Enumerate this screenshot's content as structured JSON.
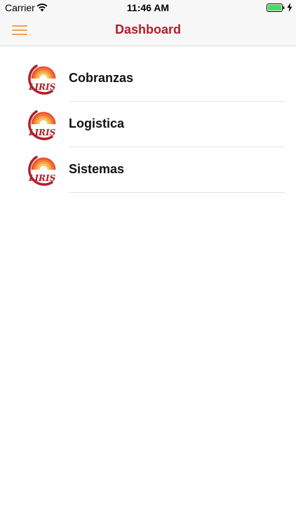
{
  "status_bar": {
    "carrier": "Carrier",
    "time": "11:46 AM",
    "icons": [
      "wifi-icon",
      "battery-icon",
      "charging-bolt-icon"
    ]
  },
  "nav": {
    "title": "Dashboard",
    "menu_icon": "hamburger-menu-icon"
  },
  "logo_text": "LIRIS",
  "items": [
    {
      "label": "Cobranzas"
    },
    {
      "label": "Logistica"
    },
    {
      "label": "Sistemas"
    }
  ],
  "colors": {
    "accent": "#f3a24a",
    "title": "#b0202a",
    "battery": "#4cd964",
    "logo_red": "#b0202a"
  }
}
